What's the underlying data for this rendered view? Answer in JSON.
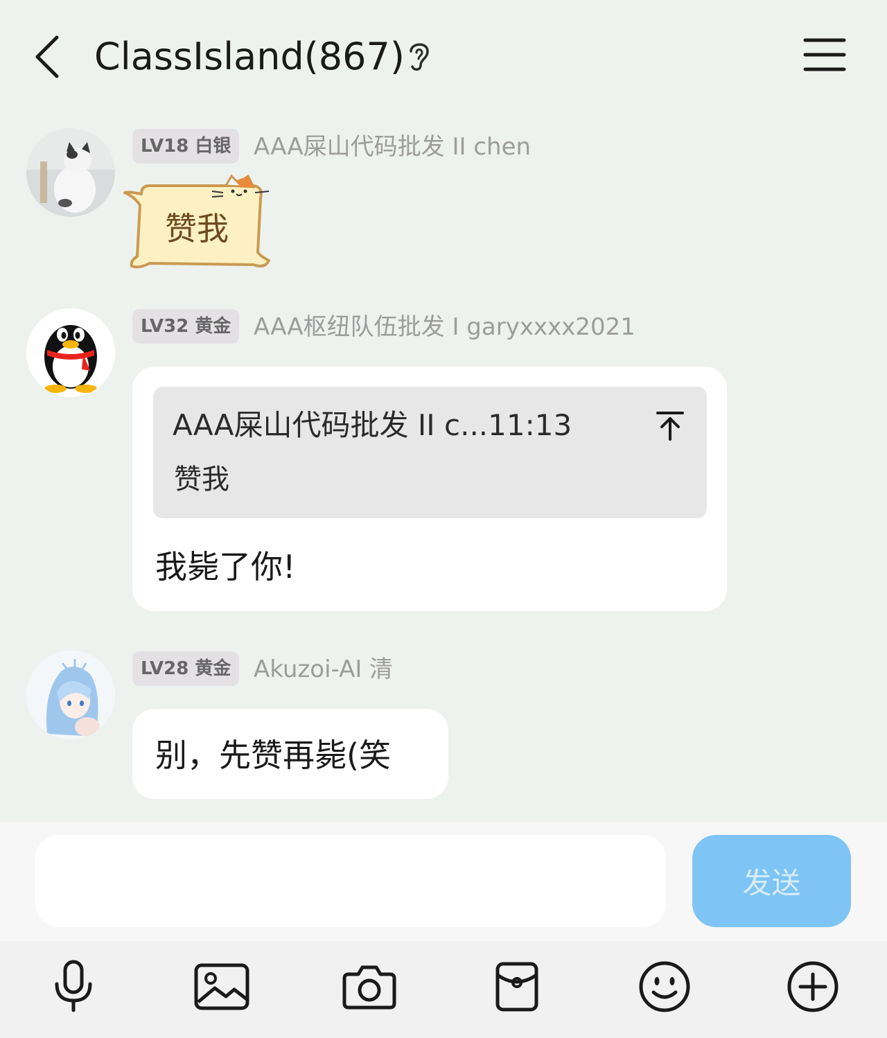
{
  "header": {
    "title": "ClassIsland(867)"
  },
  "messages": [
    {
      "level": "LV18 白银",
      "sender": "AAA屎山代码批发 II chen",
      "sticker_text": "赞我"
    },
    {
      "level": "LV32 黄金",
      "sender": "AAA枢纽队伍批发 I garyxxxx2021",
      "quote_header": "AAA屎山代码批发 II c...11:13",
      "quote_body": "赞我",
      "text": "我毙了你!"
    },
    {
      "level": "LV28 黄金",
      "sender": "Akuzoi-AI 清",
      "text": "别，先赞再毙(笑"
    }
  ],
  "composer": {
    "input_value": "",
    "input_placeholder": "",
    "send_label": "发送"
  },
  "toolbar": {
    "icons": [
      "microphone-icon",
      "image-icon",
      "camera-icon",
      "red-packet-icon",
      "emoji-icon",
      "plus-icon"
    ]
  },
  "colors": {
    "background": "#eef2ef",
    "send_button": "#7ec4f4",
    "badge": "#e3e1e4"
  }
}
